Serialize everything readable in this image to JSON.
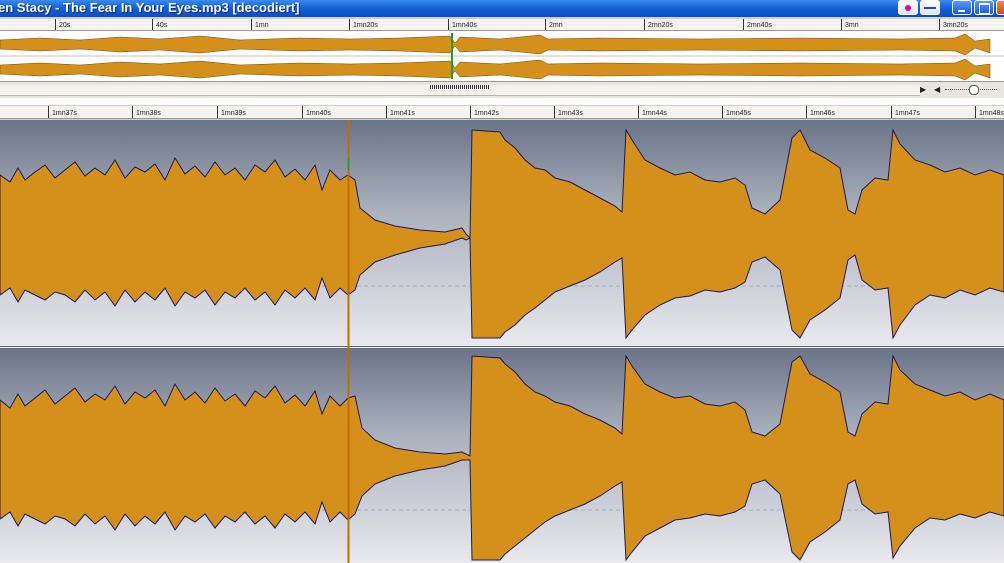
{
  "window": {
    "title": "en Stacy - The Fear In Your Eyes.mp3 [decodiert]",
    "buttons": [
      "record-icon",
      "dash-icon",
      "minimize-icon",
      "maximize-icon",
      "close-icon"
    ]
  },
  "overview_ruler": {
    "labels": [
      "20s",
      "40s",
      "1mn",
      "1mn20s",
      "1mn40s",
      "2mn",
      "2mn20s",
      "2mn40s",
      "3mn",
      "3mn20s"
    ]
  },
  "main_ruler": {
    "labels": [
      "1mn37s",
      "1mn38s",
      "1mn39s",
      "1mn40s",
      "1mn41s",
      "1mn42s",
      "1mn43s",
      "1mn44s",
      "1mn45s",
      "1mn46s",
      "1mn47s",
      "1mn48s"
    ]
  },
  "colors": {
    "waveform_fill": "#d4901a",
    "waveform_outline": "#1a1a5a",
    "background_top": "#6a7487",
    "background_bottom": "#e9e9ee",
    "playhead": "#c46a00",
    "titlebar": "#0a4ec8"
  },
  "navigation": {
    "left_arrow_icon": "triangle-left-icon",
    "right_arrow_icon": "triangle-right-icon"
  }
}
